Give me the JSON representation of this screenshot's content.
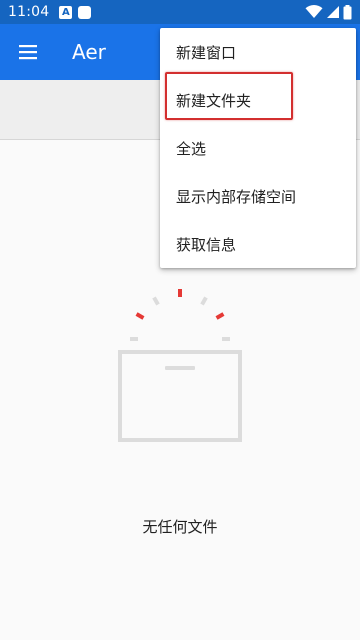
{
  "status_bar": {
    "time": "11:04",
    "notification_letter": "A"
  },
  "app_bar": {
    "title": "Aer"
  },
  "menu": {
    "items": [
      {
        "label": "新建窗口"
      },
      {
        "label": "新建文件夹"
      },
      {
        "label": "全选"
      },
      {
        "label": "显示内部存储空间"
      },
      {
        "label": "获取信息"
      }
    ]
  },
  "empty_state": {
    "message": "无任何文件"
  },
  "colors": {
    "status_bar": "#1565c0",
    "app_bar": "#1a73e8",
    "highlight": "#d32f2f",
    "illustration": "#dcdcdc",
    "spark_red": "#e53935"
  },
  "icons": {
    "menu": "hamburger-menu-icon",
    "wifi": "wifi-icon",
    "signal": "cell-signal-icon",
    "battery": "battery-icon",
    "empty": "empty-folder-icon"
  }
}
